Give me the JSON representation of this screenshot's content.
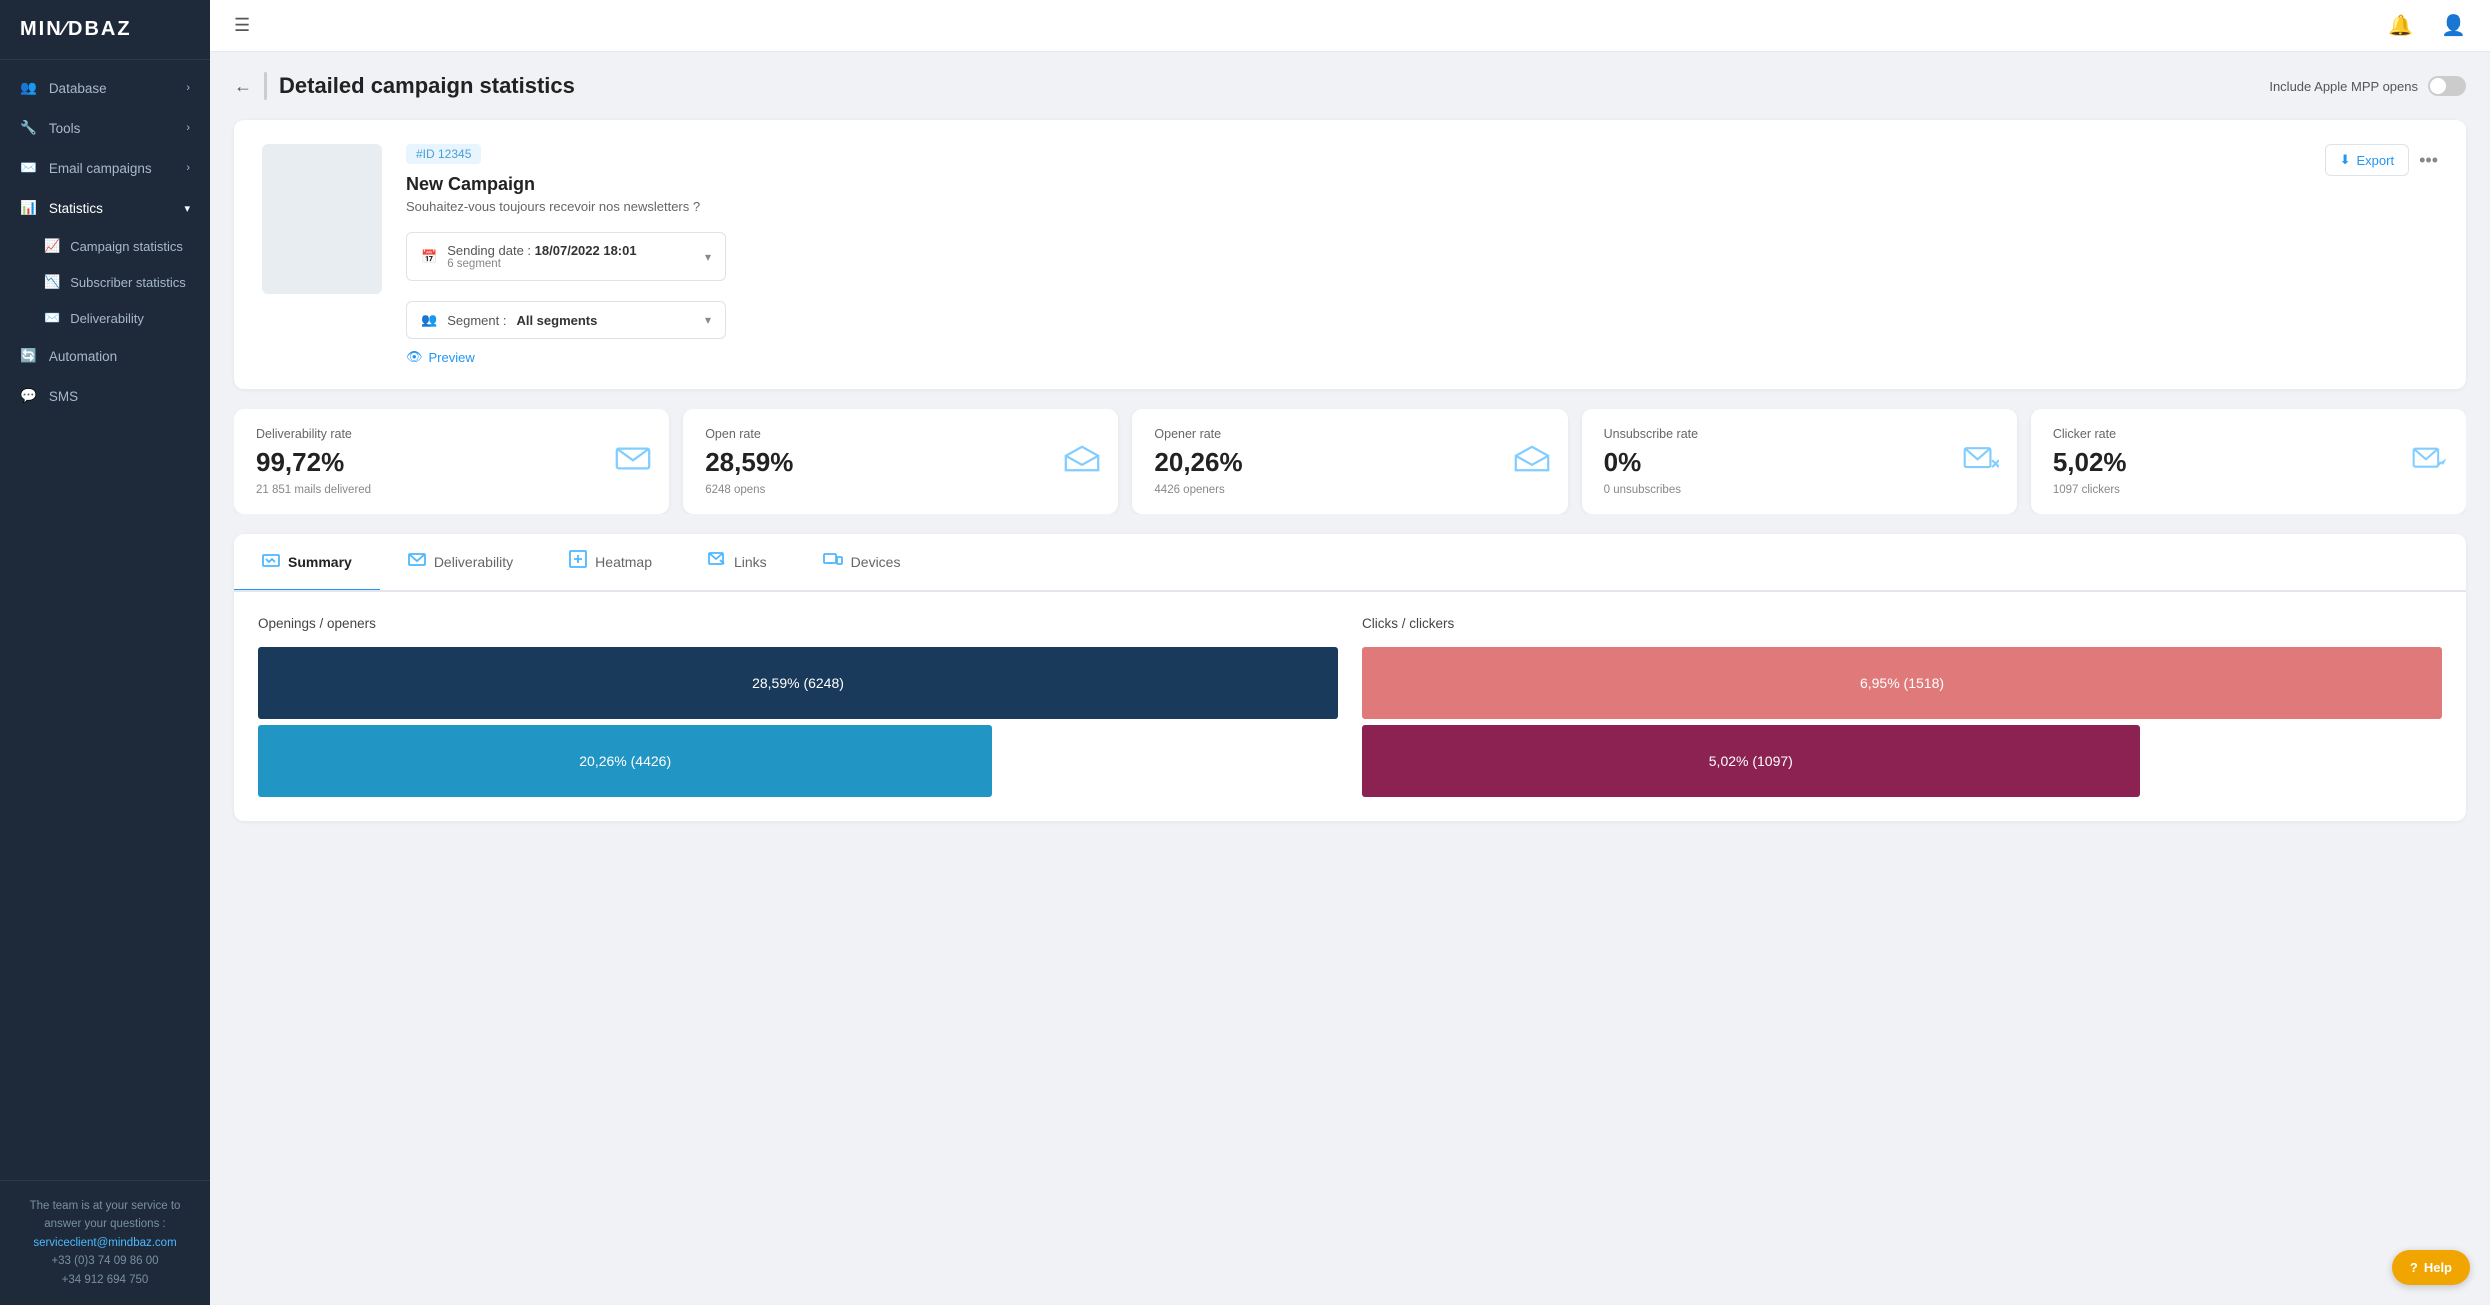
{
  "brand": {
    "logo": "MIN∕DBAZ"
  },
  "topbar": {
    "menu_icon": "☰",
    "bell_icon": "🔔",
    "user_icon": "👤"
  },
  "sidebar": {
    "items": [
      {
        "id": "database",
        "label": "Database",
        "icon": "👥",
        "hasArrow": true
      },
      {
        "id": "tools",
        "label": "Tools",
        "icon": "🔧",
        "hasArrow": true
      },
      {
        "id": "email-campaigns",
        "label": "Email campaigns",
        "icon": "✉️",
        "hasArrow": true
      },
      {
        "id": "statistics",
        "label": "Statistics",
        "icon": "📊",
        "hasArrow": true,
        "active": true
      },
      {
        "id": "automation",
        "label": "Automation",
        "icon": "🔄",
        "hasArrow": false
      },
      {
        "id": "sms",
        "label": "SMS",
        "icon": "💬",
        "hasArrow": false
      }
    ],
    "sub_items": [
      {
        "id": "campaign-statistics",
        "label": "Campaign statistics",
        "active": false
      },
      {
        "id": "subscriber-statistics",
        "label": "Subscriber statistics",
        "active": false
      },
      {
        "id": "deliverability",
        "label": "Deliverability",
        "active": false
      }
    ],
    "footer": {
      "text": "The team is at your service to answer your questions :",
      "email": "serviceclient@mindbaz.com",
      "phone1": "+33 (0)3 74 09 86 00",
      "phone2": "+34 912 694 750"
    }
  },
  "page": {
    "title": "Detailed campaign statistics",
    "back_label": "←",
    "apple_mpp_label": "Include Apple MPP opens"
  },
  "campaign": {
    "id_label": "#ID  12345",
    "name": "New Campaign",
    "subject": "Souhaitez-vous toujours recevoir nos newsletters ?",
    "sending_date_label": "Sending date :",
    "sending_date_value": "18/07/2022 18:01",
    "segment_count": "6 segment",
    "segment_label": "Segment :",
    "segment_value": "All segments",
    "preview_label": "Preview",
    "export_label": "Export",
    "more_icon": "•••"
  },
  "stats": [
    {
      "label": "Deliverability rate",
      "value": "99,72%",
      "sub": "21 851 mails delivered",
      "icon": "envelope"
    },
    {
      "label": "Open rate",
      "value": "28,59%",
      "sub": "6248 opens",
      "icon": "envelope-open"
    },
    {
      "label": "Opener rate",
      "value": "20,26%",
      "sub": "4426 openers",
      "icon": "envelope-open"
    },
    {
      "label": "Unsubscribe rate",
      "value": "0%",
      "sub": "0 unsubscribes",
      "icon": "envelope-x"
    },
    {
      "label": "Clicker rate",
      "value": "5,02%",
      "sub": "1097 clickers",
      "icon": "envelope-click"
    }
  ],
  "tabs": [
    {
      "id": "summary",
      "label": "Summary",
      "active": true
    },
    {
      "id": "deliverability",
      "label": "Deliverability",
      "active": false
    },
    {
      "id": "heatmap",
      "label": "Heatmap",
      "active": false
    },
    {
      "id": "links",
      "label": "Links",
      "active": false
    },
    {
      "id": "devices",
      "label": "Devices",
      "active": false
    }
  ],
  "charts": {
    "openings_title": "Openings / openers",
    "clicks_title": "Clicks / clickers",
    "openings_bars": [
      {
        "label": "28,59% (6248)",
        "value": 100,
        "color": "#1a3a5c"
      },
      {
        "label": "20,26% (4426)",
        "value": 68,
        "color": "#2196c4"
      }
    ],
    "clicks_bars": [
      {
        "label": "6,95% (1518)",
        "value": 100,
        "color": "#e07a7a"
      },
      {
        "label": "5,02% (1097)",
        "value": 72,
        "color": "#8b2252"
      }
    ]
  },
  "help_button": "Help"
}
